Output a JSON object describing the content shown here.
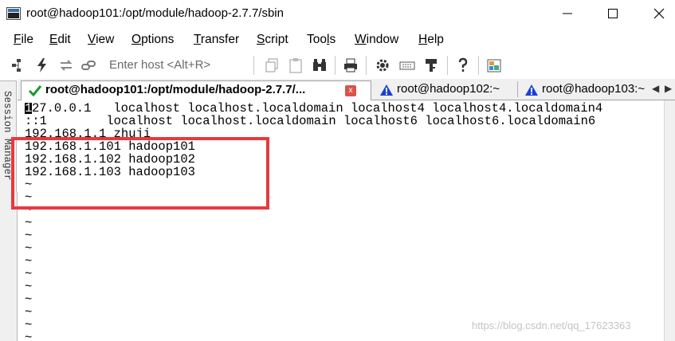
{
  "window": {
    "title": "root@hadoop101:/opt/module/hadoop-2.7.7/sbin",
    "icon": "terminal-app-icon"
  },
  "menu": [
    {
      "accel": "F",
      "rest": "ile"
    },
    {
      "accel": "E",
      "rest": "dit"
    },
    {
      "accel": "V",
      "rest": "iew"
    },
    {
      "accel": "O",
      "rest": "ptions"
    },
    {
      "accel": "T",
      "rest": "ransfer"
    },
    {
      "accel": "S",
      "rest": "cript"
    },
    {
      "pre": "Too",
      "accel": "l",
      "rest": "s"
    },
    {
      "accel": "W",
      "rest": "indow"
    },
    {
      "accel": "H",
      "rest": "elp"
    }
  ],
  "toolbar": {
    "host_placeholder": "Enter host <Alt+R>"
  },
  "session_manager": {
    "label": "Session Manager"
  },
  "tabs": [
    {
      "label": "root@hadoop101:/opt/module/hadoop-2.7.7/...",
      "status": "connected",
      "active": true,
      "close": "x"
    },
    {
      "label": "root@hadoop102:~",
      "status": "warning",
      "active": false
    },
    {
      "label": "root@hadoop103:~",
      "status": "warning",
      "active": false
    }
  ],
  "terminal": {
    "first_char": "1",
    "lines": [
      "27.0.0.1   localhost localhost.localdomain localhost4 localhost4.localdomain4",
      "::1        localhost localhost.localdomain localhost6 localhost6.localdomain6",
      "192.168.1.1 zhuji",
      "192.168.1.101 hadoop101",
      "192.168.1.102 hadoop102",
      "192.168.1.103 hadoop103",
      "~",
      "~",
      "~",
      "~",
      "~",
      "~",
      "~",
      "~",
      "~",
      "~",
      "~",
      "~",
      "~",
      "~",
      "~"
    ]
  },
  "watermark": "https://blog.csdn.net/qq_17623363",
  "colors": {
    "highlight": "#e8393d",
    "tab_connected": "#1a9a2a",
    "tab_warning": "#1a3fd6"
  }
}
